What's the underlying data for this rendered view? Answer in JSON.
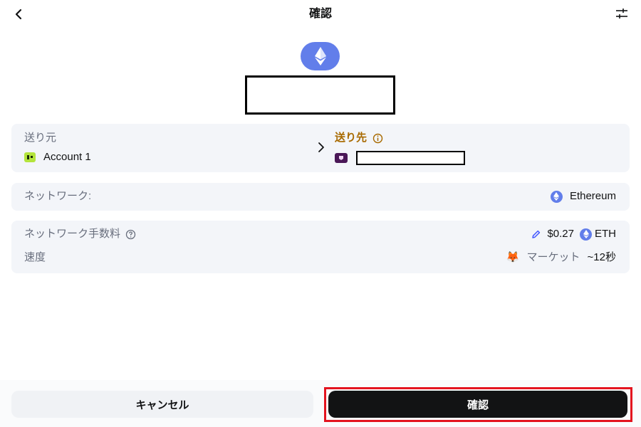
{
  "header": {
    "title": "確認",
    "back_icon": "chevron-left-icon",
    "settings_icon": "sliders-icon"
  },
  "asset": {
    "icon": "ethereum-logo-icon"
  },
  "from_to": {
    "from_label": "送り元",
    "from_account": "Account 1",
    "to_label": "送り先"
  },
  "network": {
    "label": "ネットワーク:",
    "value": "Ethereum"
  },
  "fee": {
    "label": "ネットワーク手数料",
    "amount": "$0.27",
    "currency": "ETH",
    "speed_label": "速度",
    "speed_emoji": "🦊",
    "speed_mode": "マーケット",
    "speed_time": "~12秒"
  },
  "footer": {
    "cancel_label": "キャンセル",
    "confirm_label": "確認"
  },
  "colors": {
    "eth": "#627eea",
    "to_label": "#a86a00",
    "confirm_bg": "#121314",
    "highlight": "#e3141f"
  }
}
